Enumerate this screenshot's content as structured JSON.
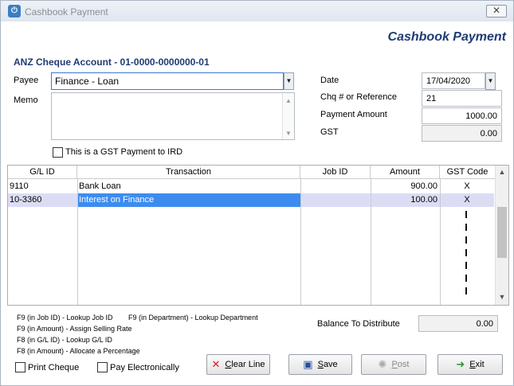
{
  "window": {
    "title": "Cashbook Payment"
  },
  "header": {
    "title": "Cashbook Payment",
    "account": "ANZ Cheque Account - 01-0000-0000000-01"
  },
  "payee": {
    "label": "Payee",
    "value": "Finance - Loan"
  },
  "memo": {
    "label": "Memo",
    "value": ""
  },
  "gst_checkbox": {
    "label": "This is a GST Payment to IRD",
    "checked": false
  },
  "date": {
    "label": "Date",
    "value": "17/04/2020"
  },
  "reference": {
    "label": "Chq # or Reference",
    "value": "21"
  },
  "payment_amount": {
    "label": "Payment Amount",
    "value": "1000.00"
  },
  "gst": {
    "label": "GST",
    "value": "0.00"
  },
  "grid": {
    "columns": [
      "G/L ID",
      "Transaction",
      "Job ID",
      "Amount",
      "GST Code"
    ],
    "rows": [
      {
        "gl_id": "9110",
        "transaction": "Bank Loan",
        "job_id": "",
        "amount": "900.00",
        "gst_code": "X"
      },
      {
        "gl_id": "10-3360",
        "transaction": "Interest on Finance",
        "job_id": "",
        "amount": "100.00",
        "gst_code": "X"
      }
    ]
  },
  "hints": [
    "F9 (in Job ID) - Lookup Job ID",
    "F9 (in Department) - Lookup Department",
    "F9 (in Amount) - Assign Selling Rate",
    "F8 (in G/L ID) - Lookup G/L ID",
    "F8 (in Amount) - Allocate a Percentage"
  ],
  "balance": {
    "label": "Balance To Distribute",
    "value": "0.00"
  },
  "options": {
    "print_cheque": "Print Cheque",
    "pay_electronically": "Pay Electronically"
  },
  "buttons": {
    "clear_first": "C",
    "clear_rest": "lear Line",
    "save_first": "S",
    "save_rest": "ave",
    "post_first": "P",
    "post_rest": "ost",
    "exit_first": "E",
    "exit_rest": "xit"
  },
  "colors": {
    "heading": "#1f3b73",
    "selection": "#3c8cf0",
    "row_highlight": "#dcdcf5"
  }
}
